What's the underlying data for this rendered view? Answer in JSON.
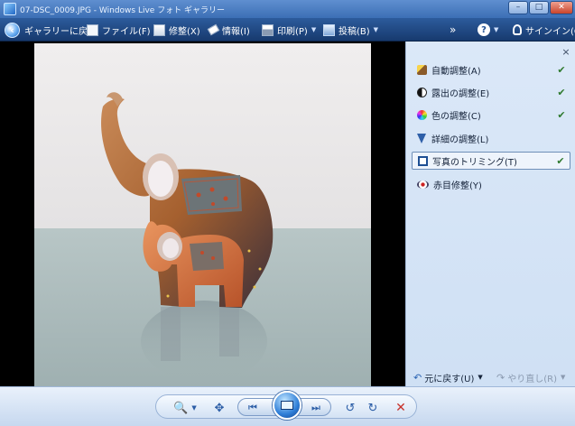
{
  "window": {
    "title": "07-DSC_0009.JPG - Windows Live フォト ギャラリー",
    "buttons": {
      "minimize": "–",
      "maximize": "□",
      "close": "✕"
    }
  },
  "toolbar": {
    "back_label": "ギャラリーに戻る",
    "file_label": "ファイル(F)",
    "fix_label": "修整(X)",
    "info_label": "情報(I)",
    "print_label": "印刷(P)",
    "post_label": "投稿(B)",
    "more_label": "»",
    "help_label": "?",
    "signin_label": "サインイン(G)"
  },
  "panel": {
    "close": "×",
    "items": [
      {
        "label": "自動調整(A)",
        "icon": "magic-wand-icon",
        "checked": true,
        "selected": false
      },
      {
        "label": "露出の調整(E)",
        "icon": "exposure-icon",
        "checked": true,
        "selected": false
      },
      {
        "label": "色の調整(C)",
        "icon": "color-wheel-icon",
        "checked": true,
        "selected": false
      },
      {
        "label": "詳細の調整(L)",
        "icon": "detail-icon",
        "checked": false,
        "selected": false
      },
      {
        "label": "写真のトリミング(T)",
        "icon": "crop-icon",
        "checked": true,
        "selected": true
      },
      {
        "label": "赤目修整(Y)",
        "icon": "red-eye-icon",
        "checked": false,
        "selected": false
      }
    ],
    "check_glyph": "✔",
    "undo_label": "元に戻す(U)",
    "redo_label": "やり直し(R)"
  },
  "bottombar": {
    "zoom_icon": "🔍",
    "fit_icon": "✥",
    "prev_icon": "⏮",
    "next_icon": "⏭",
    "rotate_ccw_icon": "↺",
    "rotate_cw_icon": "↻",
    "delete_icon": "✕"
  }
}
